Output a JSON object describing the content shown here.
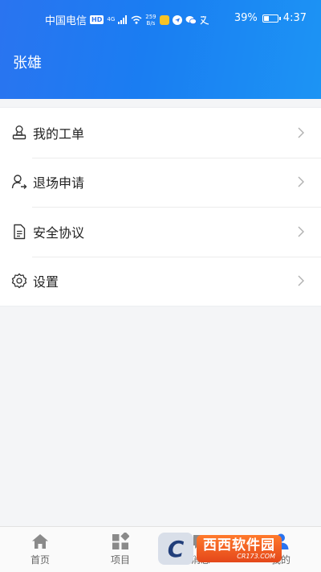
{
  "status_bar": {
    "carrier": "中国电信",
    "hd_badge": "HD",
    "network": "4G",
    "speed_value": "259",
    "speed_unit": "B/s",
    "battery_percent_text": "39%",
    "battery_level": 0.39,
    "time": "4:37"
  },
  "header": {
    "user_name": "张雄"
  },
  "menu": {
    "items": [
      {
        "label": "我的工单",
        "icon": "person-stamp-icon"
      },
      {
        "label": "退场申请",
        "icon": "person-exit-icon"
      },
      {
        "label": "安全协议",
        "icon": "document-icon"
      },
      {
        "label": "设置",
        "icon": "gear-icon"
      }
    ]
  },
  "tabbar": {
    "tabs": [
      {
        "label": "首页",
        "icon": "home-icon"
      },
      {
        "label": "项目",
        "icon": "grid-icon"
      },
      {
        "label": "消息",
        "icon": "message-icon"
      },
      {
        "label": "我的",
        "icon": "user-icon"
      }
    ]
  },
  "watermark": {
    "main_text": "西西软件园",
    "sub_text": "CR173.COM",
    "logo_text": "C"
  },
  "colors": {
    "header_gradient_start": "#2a74f0",
    "header_gradient_end": "#1c94f4",
    "page_background": "#f4f5f7",
    "watermark_orange": "#e4471a"
  }
}
